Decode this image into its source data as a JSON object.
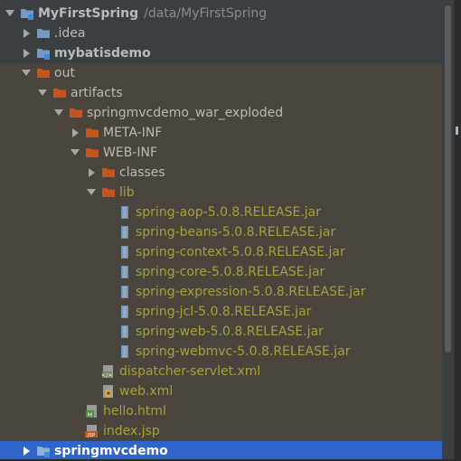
{
  "tree": {
    "rows": [
      {
        "label": "MyFirstSpring",
        "path": "/data/MyFirstSpring",
        "icon": "module-folder-icon",
        "arrow": "expanded",
        "bold": true
      },
      {
        "label": ".idea",
        "icon": "folder-icon",
        "arrow": "collapsed"
      },
      {
        "label": "mybatisdemo",
        "icon": "module-folder-icon",
        "arrow": "collapsed",
        "bold": true
      },
      {
        "label": "out",
        "icon": "excluded-folder-icon",
        "arrow": "expanded"
      },
      {
        "label": "artifacts",
        "icon": "excluded-folder-icon",
        "arrow": "expanded"
      },
      {
        "label": "springmvcdemo_war_exploded",
        "icon": "excluded-folder-icon",
        "arrow": "expanded"
      },
      {
        "label": "META-INF",
        "icon": "excluded-folder-icon",
        "arrow": "collapsed"
      },
      {
        "label": "WEB-INF",
        "icon": "excluded-folder-icon",
        "arrow": "expanded"
      },
      {
        "label": "classes",
        "icon": "excluded-folder-icon",
        "arrow": "collapsed"
      },
      {
        "label": "lib",
        "icon": "excluded-folder-icon",
        "arrow": "expanded"
      },
      {
        "label": "spring-aop-5.0.8.RELEASE.jar",
        "icon": "jar-icon"
      },
      {
        "label": "spring-beans-5.0.8.RELEASE.jar",
        "icon": "jar-icon"
      },
      {
        "label": "spring-context-5.0.8.RELEASE.jar",
        "icon": "jar-icon"
      },
      {
        "label": "spring-core-5.0.8.RELEASE.jar",
        "icon": "jar-icon"
      },
      {
        "label": "spring-expression-5.0.8.RELEASE.jar",
        "icon": "jar-icon"
      },
      {
        "label": "spring-jcl-5.0.8.RELEASE.jar",
        "icon": "jar-icon"
      },
      {
        "label": "spring-web-5.0.8.RELEASE.jar",
        "icon": "jar-icon"
      },
      {
        "label": "spring-webmvc-5.0.8.RELEASE.jar",
        "icon": "jar-icon"
      },
      {
        "label": "dispatcher-servlet.xml",
        "icon": "spring-xml-icon"
      },
      {
        "label": "web.xml",
        "icon": "web-xml-icon"
      },
      {
        "label": "hello.html",
        "icon": "html-file-icon"
      },
      {
        "label": "index.jsp",
        "icon": "jsp-file-icon"
      },
      {
        "label": "springmvcdemo",
        "icon": "module-folder-icon",
        "arrow": "collapsed",
        "bold": true
      }
    ],
    "icon_labels": {
      "html": "H",
      "jsp": "JSP",
      "xml": "</>"
    }
  },
  "colors": {
    "panel_bg": "#3c3f41",
    "excluded_bg": "#49443c",
    "selection": "#2f65ca",
    "excluded_text": "#a6a33a",
    "text": "#bbbbbb",
    "folder_blue": "#7899c4",
    "folder_orange": "#c5551e"
  }
}
